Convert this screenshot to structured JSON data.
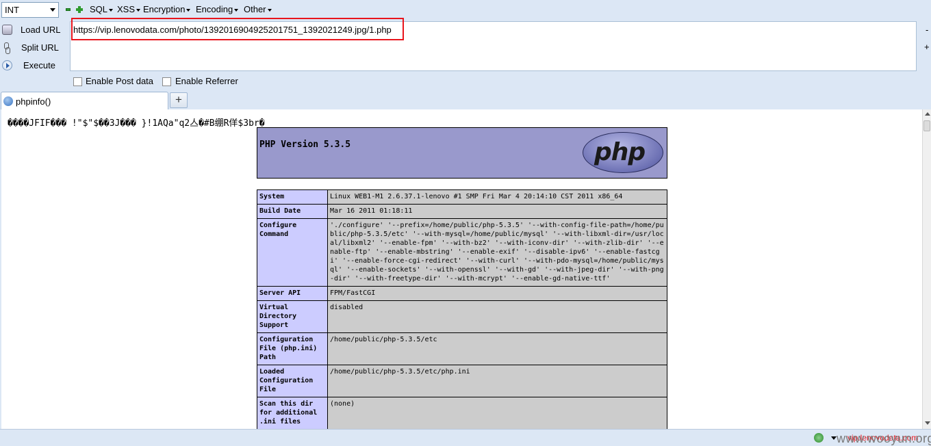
{
  "toolbar": {
    "select_value": "INT",
    "menus": [
      "SQL",
      "XSS",
      "Encryption",
      "Encoding",
      "Other"
    ]
  },
  "actions": {
    "load_url": "Load URL",
    "split_url": "Split URL",
    "execute": "Execute"
  },
  "url_box": {
    "value": "https://vip.lenovodata.com/photo/1392016904925201751_1392021249.jpg/1.php",
    "side_minus": "-",
    "side_plus": "+"
  },
  "options": {
    "enable_post": "Enable Post data",
    "enable_referrer": "Enable Referrer"
  },
  "tabs": {
    "active_title": "phpinfo()",
    "new_tab_label": "+"
  },
  "content": {
    "garbage_line": "����JFIF��� !\"$\"$��3J��� }!1AQa\"q2亼�#B绷R佯$3br�",
    "php_version": "PHP Version 5.3.5",
    "logo_text": "php",
    "rows": [
      {
        "key": "System",
        "value": "Linux WEB1-M1 2.6.37.1-lenovo #1 SMP Fri Mar 4 20:14:10 CST 2011 x86_64"
      },
      {
        "key": "Build Date",
        "value": "Mar 16 2011 01:18:11"
      },
      {
        "key": "Configure Command",
        "value": "'./configure' '--prefix=/home/public/php-5.3.5' '--with-config-file-path=/home/public/php-5.3.5/etc' '--with-mysql=/home/public/mysql' '--with-libxml-dir=/usr/local/libxml2' '--enable-fpm' '--with-bz2' '--with-iconv-dir' '--with-zlib-dir' '--enable-ftp' '--enable-mbstring' '--enable-exif' '--disable-ipv6' '--enable-fastcgi' '--enable-force-cgi-redirect' '--with-curl' '--with-pdo-mysql=/home/public/mysql' '--enable-sockets' '--with-openssl' '--with-gd' '--with-jpeg-dir' '--with-png-dir' '--with-freetype-dir' '--with-mcrypt' '--enable-gd-native-ttf'"
      },
      {
        "key": "Server API",
        "value": "FPM/FastCGI"
      },
      {
        "key": "Virtual Directory Support",
        "value": "disabled"
      },
      {
        "key": "Configuration File (php.ini) Path",
        "value": "/home/public/php-5.3.5/etc"
      },
      {
        "key": "Loaded Configuration File",
        "value": "/home/public/php-5.3.5/etc/php.ini"
      },
      {
        "key": "Scan this dir for additional .ini files",
        "value": "(none)"
      }
    ]
  },
  "status": {
    "domain": "vip.lenovodata.com",
    "watermark": "www.wooyun.org"
  },
  "colors": {
    "highlight_box": "#e8141b",
    "php_header": "#9999cc",
    "key_cell": "#ccccff",
    "value_cell": "#cccccc"
  }
}
